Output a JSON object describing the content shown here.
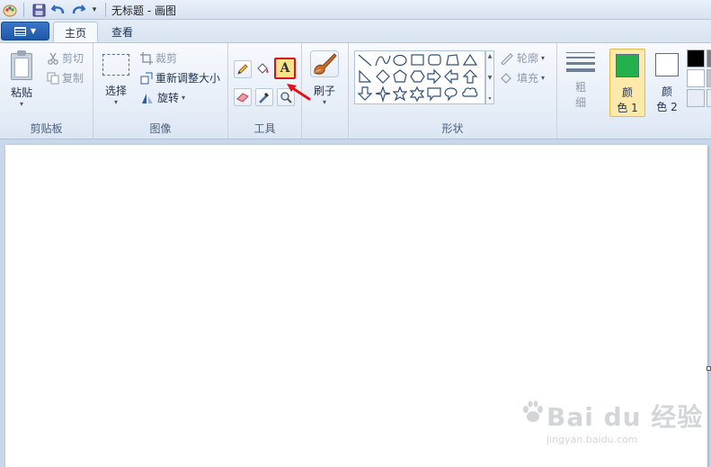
{
  "window": {
    "title": "无标题 - 画图"
  },
  "tabs": {
    "home": "主页",
    "view": "查看"
  },
  "clipboard": {
    "paste": "粘贴",
    "cut": "剪切",
    "copy": "复制",
    "group": "剪贴板"
  },
  "image": {
    "select": "选择",
    "crop": "裁剪",
    "resize": "重新调整大小",
    "rotate": "旋转",
    "group": "图像"
  },
  "tools": {
    "group": "工具",
    "text_glyph": "A"
  },
  "brushes": {
    "label": "刷子"
  },
  "shapes": {
    "outline": "轮廓",
    "fill": "填充",
    "group": "形状"
  },
  "size": {
    "label_top": "粗",
    "label_bottom": "细"
  },
  "colors": {
    "color1_top": "颜",
    "color1_bottom": "色 1",
    "color2_top": "颜",
    "color2_bottom": "色 2",
    "color1_value": "#22b14c",
    "color2_value": "#ffffff"
  },
  "watermark": {
    "text": "Bai du 经验",
    "sub": "jingyan.baidu.com"
  }
}
